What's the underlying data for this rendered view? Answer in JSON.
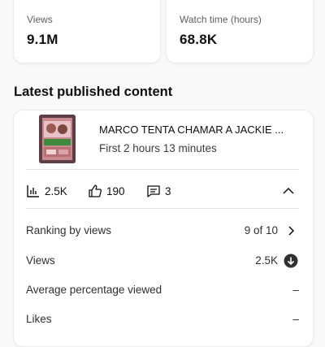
{
  "stats": [
    {
      "label": "Views",
      "value": "9.1M"
    },
    {
      "label": "Watch time (hours)",
      "value": "68.8K"
    }
  ],
  "latest": {
    "section_title": "Latest published content",
    "video": {
      "title": "MARCO TENTA CHAMAR A JACKIE ...",
      "subtitle": "First 2 hours 13 minutes"
    },
    "metrics": {
      "views": "2.5K",
      "likes": "190",
      "comments": "3"
    },
    "details": [
      {
        "label": "Ranking by views",
        "value": "9 of 10"
      },
      {
        "label": "Views",
        "value": "2.5K"
      },
      {
        "label": "Average percentage viewed",
        "value": "–"
      },
      {
        "label": "Likes",
        "value": "–"
      }
    ]
  },
  "icons": {
    "views": "bar-chart-icon",
    "likes": "thumbs-up-icon",
    "comments": "comment-icon",
    "collapse": "chevron-up-icon",
    "ranking": "chevron-right-icon",
    "views_trend": "arrow-down-circle-icon"
  },
  "colors": {
    "background": "#f9f9f9",
    "card": "#ffffff",
    "text": "#0f0f0f",
    "secondary": "#606060"
  }
}
